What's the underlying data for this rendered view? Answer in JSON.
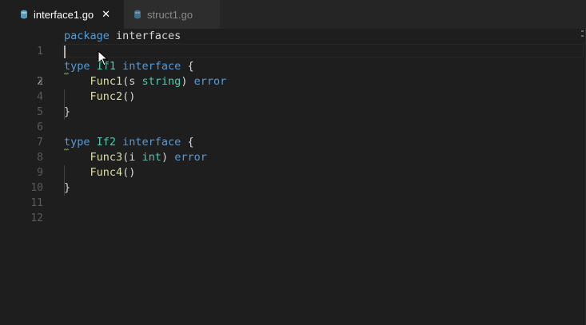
{
  "tabs": [
    {
      "label": "interface1.go",
      "active": true,
      "close": "✕",
      "icon": "go-file-icon"
    },
    {
      "label": "struct1.go",
      "active": false,
      "icon": "go-file-icon"
    }
  ],
  "editor": {
    "current_line": 2,
    "lines": [
      {
        "n": "1"
      },
      {
        "n": "2"
      },
      {
        "n": "3"
      },
      {
        "n": "4"
      },
      {
        "n": "5"
      },
      {
        "n": "6"
      },
      {
        "n": "7"
      },
      {
        "n": "8"
      },
      {
        "n": "9"
      },
      {
        "n": "10"
      },
      {
        "n": "11"
      },
      {
        "n": "12"
      }
    ],
    "code": {
      "l1_kw": "package",
      "l1_name": " interfaces",
      "l3_kw": "type",
      "l3_name": " If1",
      "l3_kw2": " interface",
      "l3_brace": " {",
      "l4_fn": "    Func1",
      "l4_p1": "(s ",
      "l4_ty": "string",
      "l4_p2": ") ",
      "l4_ret": "error",
      "l5_fn": "    Func2",
      "l5_p": "()",
      "l6_close": "}",
      "l8_kw": "type",
      "l8_name": " If2",
      "l8_kw2": " interface",
      "l8_brace": " {",
      "l9_fn": "    Func3",
      "l9_p1": "(i ",
      "l9_ty": "int",
      "l9_p2": ") ",
      "l9_ret": "error",
      "l10_fn": "    Func4",
      "l10_p": "()",
      "l11_close": "}"
    }
  },
  "colors": {
    "keyword": "#569cd6",
    "type": "#4ec9b0",
    "function": "#dcdcaa",
    "text": "#d4d4d4",
    "background": "#1e1e1e"
  }
}
